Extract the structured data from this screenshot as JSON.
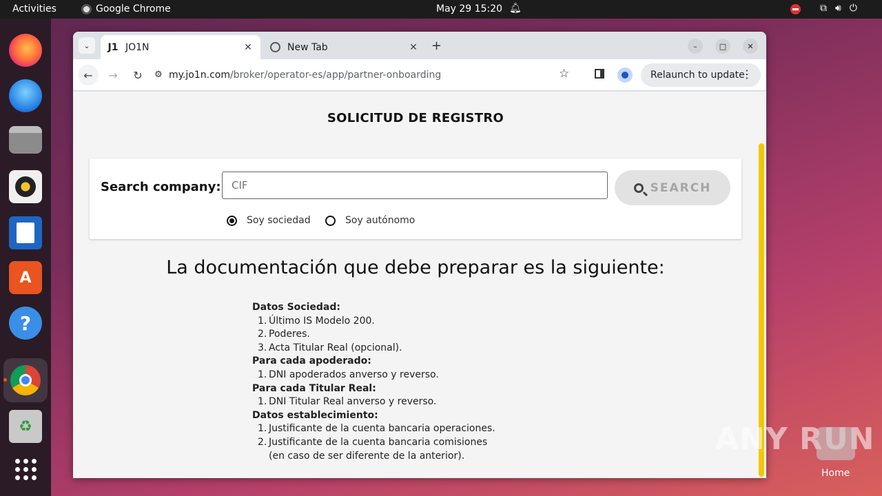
{
  "topbar": {
    "activities": "Activities",
    "app_name": "Google Chrome",
    "clock": "May 29  15:20"
  },
  "dock": {
    "items": [
      "firefox-icon",
      "thunderbird-icon",
      "files-icon",
      "rhythmbox-icon",
      "writer-icon",
      "app-center-icon",
      "help-icon",
      "chrome-icon",
      "trash-icon",
      "app-grid-icon"
    ]
  },
  "browser": {
    "tabs": [
      {
        "favicon": "J1",
        "title": "JO1N",
        "active": true
      },
      {
        "title": "New Tab",
        "active": false
      }
    ],
    "url_domain": "my.jo1n.com",
    "url_path": "/broker/operator-es/app/partner-onboarding",
    "relaunch_label": "Relaunch to update"
  },
  "page": {
    "title": "SOLICITUD DE REGISTRO",
    "search_label": "Search company:",
    "search_placeholder": "CIF",
    "search_button": "SEARCH",
    "radio_options": [
      {
        "label": "Soy sociedad",
        "checked": true
      },
      {
        "label": "Soy autónomo",
        "checked": false
      }
    ],
    "doc_heading": "La documentación que debe preparar es la siguiente:",
    "sections": [
      {
        "title": "Datos Sociedad:",
        "items": [
          "Último IS Modelo 200.",
          "Poderes.",
          "Acta Titular Real (opcional)."
        ]
      },
      {
        "title": "Para cada apoderado:",
        "items": [
          "DNI apoderados anverso y reverso."
        ]
      },
      {
        "title": "Para cada Titular Real:",
        "items": [
          "DNI Titular Real anverso y reverso."
        ]
      },
      {
        "title": "Datos establecimiento:",
        "items": [
          "Justificante de la cuenta bancaria operaciones.",
          "Justificante de la cuenta bancaria comisiones"
        ],
        "continuation": "(en caso de ser diferente de la anterior)."
      }
    ]
  },
  "desktop": {
    "watermark": "ANY RUN",
    "home_label": "Home"
  },
  "colors": {
    "accent_scrollbar": "#f2c700",
    "topbar": "#1c1c1c",
    "ubuntu_orange": "#e95420"
  }
}
